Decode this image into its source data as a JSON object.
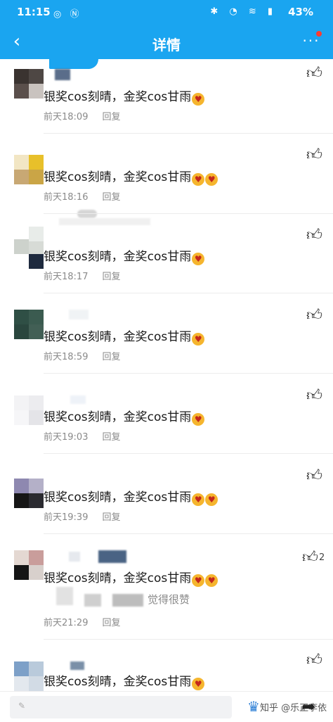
{
  "status_bar": {
    "time": "11:15",
    "battery": "43%"
  },
  "header": {
    "title": "详情",
    "more": "···"
  },
  "comments": [
    {
      "text": "银奖cos刻晴，金奖cos甘雨",
      "date": "前天18:09",
      "reply": "回复",
      "emoji_count": 1
    },
    {
      "text": "银奖cos刻晴，金奖cos甘雨",
      "date": "前天18:16",
      "reply": "回复",
      "emoji_count": 2
    },
    {
      "text": "银奖cos刻晴，金奖cos甘雨",
      "date": "前天18:17",
      "reply": "回复",
      "emoji_count": 1
    },
    {
      "text": "银奖cos刻晴，金奖cos甘雨",
      "date": "前天18:59",
      "reply": "回复",
      "emoji_count": 1
    },
    {
      "text": "银奖cos刻晴，金奖cos甘雨",
      "date": "前天19:03",
      "reply": "回复",
      "emoji_count": 1
    },
    {
      "text": "银奖cos刻晴，金奖cos甘雨",
      "date": "前天19:39",
      "reply": "回复",
      "emoji_count": 2
    },
    {
      "text": "银奖cos刻晴，金奖cos甘雨",
      "date": "前天21:29",
      "reply": "回复",
      "emoji_count": 2,
      "like_count": "2",
      "subreply": "觉得很赞"
    },
    {
      "text": "银奖cos刻晴，金奖cos甘雨",
      "emoji_count": 1
    }
  ],
  "bottom_bar": {
    "watermark": "知乎 @乐正李依"
  },
  "colors": {
    "brand": "#1aa5f0",
    "meta": "#8a8a8a"
  },
  "icons": {
    "back": "chevron-left-icon",
    "more": "more-dots-icon",
    "like": "thumbs-up-icon",
    "share": "share-arrow-icon",
    "emoji": "heart-eyes-emoji-icon"
  }
}
